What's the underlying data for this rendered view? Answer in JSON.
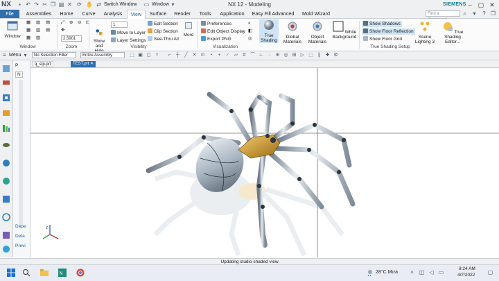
{
  "titlebar": {
    "app_logo": "NX",
    "window_title": "NX 12 - Modeling",
    "brand": "SIEMENS",
    "switch_window": "Switch Window",
    "window_menu": "Window"
  },
  "menu_tabs": [
    "File",
    "Assemblies",
    "Home",
    "Curve",
    "Analysis",
    "View",
    "Surface",
    "Render",
    "Tools",
    "Application",
    "Easy Fill Advanced",
    "Mold Wizard"
  ],
  "active_tab": "View",
  "search_placeholder": "Find a Command",
  "ribbon": {
    "window_group": {
      "label": "Window",
      "button": "Window"
    },
    "zoom_group": {
      "label": "Zoom",
      "value": "2.5901",
      "spinner": "1"
    },
    "visibility_group": {
      "label": "Visibility",
      "show_hide": "Show and Hide",
      "move_to_layer": "Move to Layer",
      "layer_settings": "Layer Settings",
      "edit_section": "Edit Section",
      "clip_section": "Clip Section",
      "see_thru_all": "See-Thru All",
      "more": "More"
    },
    "visualization_group": {
      "label": "Visualization",
      "preferences": "Preferences",
      "edit_object_display": "Edit Object Display",
      "export_png": "Export PNG",
      "true_shading": "True Shading",
      "global_materials": "Global Materials",
      "object_materials": "Object Materials",
      "white_background": "White Background"
    },
    "true_shading_group": {
      "label": "True Shading Setup",
      "show_shadows": "Show Shadows",
      "show_floor_reflection": "Show Floor Reflection",
      "show_floor_grid": "Show Floor Grid",
      "scene_lighting": "Scene Lighting 3",
      "true_shading_editor": "True Shading Editor..."
    }
  },
  "toolbar": {
    "menu": "Menu",
    "selection_filter": "No Selection Filter",
    "assembly_scope": "Entire Assembly"
  },
  "nav_panel": {
    "items": [
      "P",
      "N",
      "Depe",
      "Deta",
      "Previ"
    ]
  },
  "doc_tabs": [
    {
      "label": "q_stp.prt",
      "active": false
    },
    {
      "label": "TEST.prt",
      "active": true
    }
  ],
  "status_text": "Updating studio shaded view",
  "taskbar": {
    "weather": "28°C  Mưa",
    "time": "8:24 AM",
    "date": "4/7/2022"
  },
  "colors": {
    "file_tab": "#2f6fb0",
    "accent": "#1b5ea7",
    "spider_metal": "#b7c3cd",
    "spider_gold": "#d9a12b"
  }
}
